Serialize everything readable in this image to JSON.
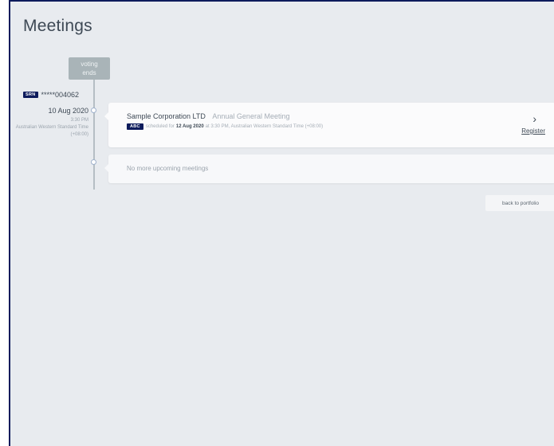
{
  "header": {
    "title": "Meetings"
  },
  "timeline": {
    "marker": "voting\nends"
  },
  "account": {
    "badge": "SRN",
    "number": "*****004062"
  },
  "meetings": [
    {
      "date": "10 Aug 2020",
      "time": "3:30 PM",
      "timezone": "Australian Western Standard Time (+08:00)",
      "company": "Sample Corporation LTD",
      "type": "Annual General Meeting",
      "badge": "ABC",
      "scheduled_prefix": "scheduled for",
      "scheduled_date": "12 Aug 2020",
      "scheduled_suffix": "at 3:30 PM, Australian Western Standard Time (+08:00)",
      "action_label": "Register",
      "chevron": "chevron-right-icon"
    }
  ],
  "empty_state": {
    "text": "No more upcoming meetings"
  },
  "actions": {
    "back_label": "back to portfolio"
  },
  "colors": {
    "background": "#e8ebef",
    "badge": "#0d1b5c",
    "text": "#3e4955",
    "muted": "#9ba4ad",
    "marker": "#a9b4b8"
  }
}
